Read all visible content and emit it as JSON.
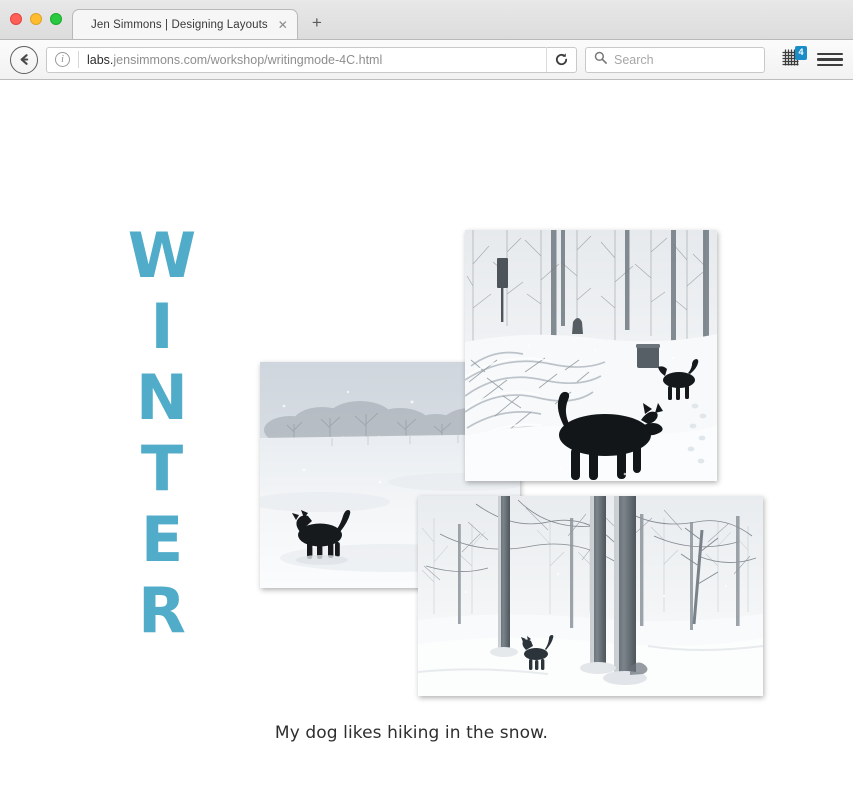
{
  "window": {
    "traffic_lights": [
      "close",
      "minimize",
      "maximize"
    ]
  },
  "tabs": [
    {
      "title": "Jen Simmons | Designing Layouts",
      "close_label": "✕",
      "active": true
    }
  ],
  "new_tab_label": "+",
  "toolbar": {
    "back_label": "Back",
    "info_label": "ⓘ",
    "url": "labs.jensimmons.com/workshop/writingmode-4C.html",
    "url_host": "labs.",
    "url_path": "jensimmons.com/workshop/writingmode-4C.html",
    "reload_label": "Reload",
    "search_placeholder": "Search",
    "search_value": "",
    "grid_badge": "4",
    "menu_label": "Menu"
  },
  "page": {
    "heading_word": "WINTER",
    "heading_letters": [
      "W",
      "I",
      "N",
      "T",
      "E",
      "R"
    ],
    "heading_color": "#50acc9",
    "caption": "My dog likes hiking in the snow.",
    "photos": [
      {
        "name": "dog-in-snowy-field",
        "alt": "A black dog standing in a wide snow-covered field with a row of bare trees in the fog behind."
      },
      {
        "name": "two-dogs-in-snowy-woods",
        "alt": "Two black dogs walking through deep snow in woods with snow-laden fallen branches."
      },
      {
        "name": "dog-among-snowy-trees",
        "alt": "A small black dog standing among tall bare trees in a snowy park."
      }
    ]
  }
}
